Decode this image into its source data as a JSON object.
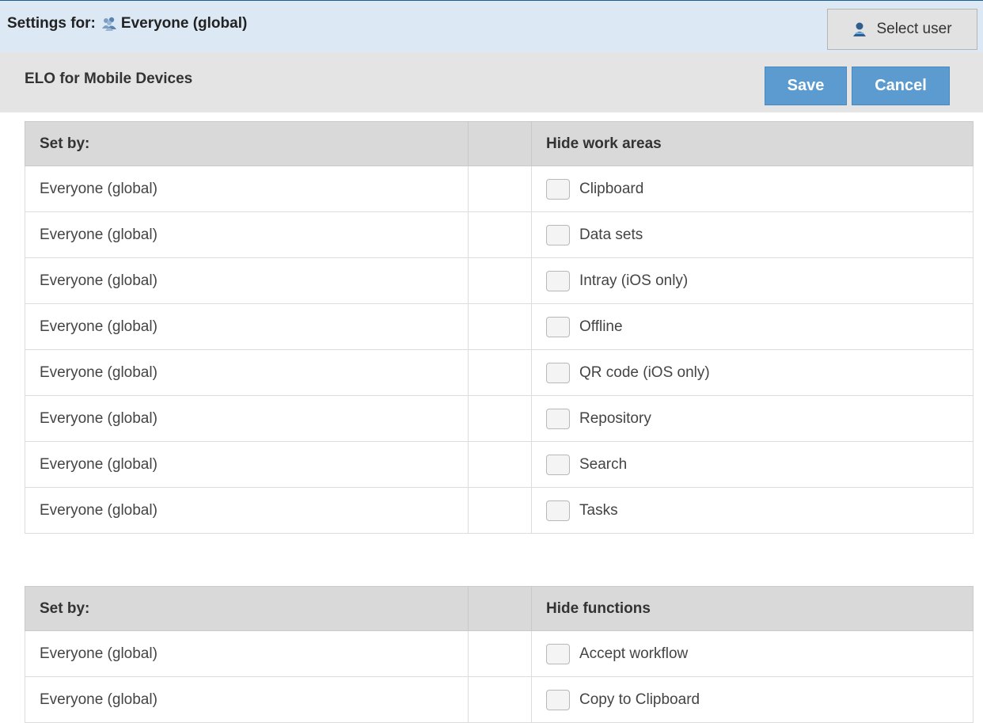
{
  "header": {
    "settings_for_label": "Settings for:",
    "scope_name": "Everyone (global)",
    "select_user_label": "Select user"
  },
  "subheader": {
    "title": "ELO for Mobile Devices",
    "save_label": "Save",
    "cancel_label": "Cancel"
  },
  "work_areas": {
    "col_set_by": "Set by:",
    "col_section": "Hide work areas",
    "rows": [
      {
        "set_by": "Everyone (global)",
        "label": "Clipboard",
        "checked": false
      },
      {
        "set_by": "Everyone (global)",
        "label": "Data sets",
        "checked": false
      },
      {
        "set_by": "Everyone (global)",
        "label": "Intray (iOS only)",
        "checked": false
      },
      {
        "set_by": "Everyone (global)",
        "label": "Offline",
        "checked": false
      },
      {
        "set_by": "Everyone (global)",
        "label": "QR code (iOS only)",
        "checked": false
      },
      {
        "set_by": "Everyone (global)",
        "label": "Repository",
        "checked": false
      },
      {
        "set_by": "Everyone (global)",
        "label": "Search",
        "checked": false
      },
      {
        "set_by": "Everyone (global)",
        "label": "Tasks",
        "checked": false
      }
    ]
  },
  "functions": {
    "col_set_by": "Set by:",
    "col_section": "Hide functions",
    "rows": [
      {
        "set_by": "Everyone (global)",
        "label": "Accept workflow",
        "checked": false
      },
      {
        "set_by": "Everyone (global)",
        "label": "Copy to Clipboard",
        "checked": false
      }
    ]
  },
  "icons": {
    "scope": "group-icon",
    "select_user": "user-icon"
  },
  "colors": {
    "header_bg": "#dde8f5",
    "subheader_bg": "#e4e4e4",
    "button_bg": "#5b9bd0",
    "table_header_bg": "#d9d9d9"
  }
}
